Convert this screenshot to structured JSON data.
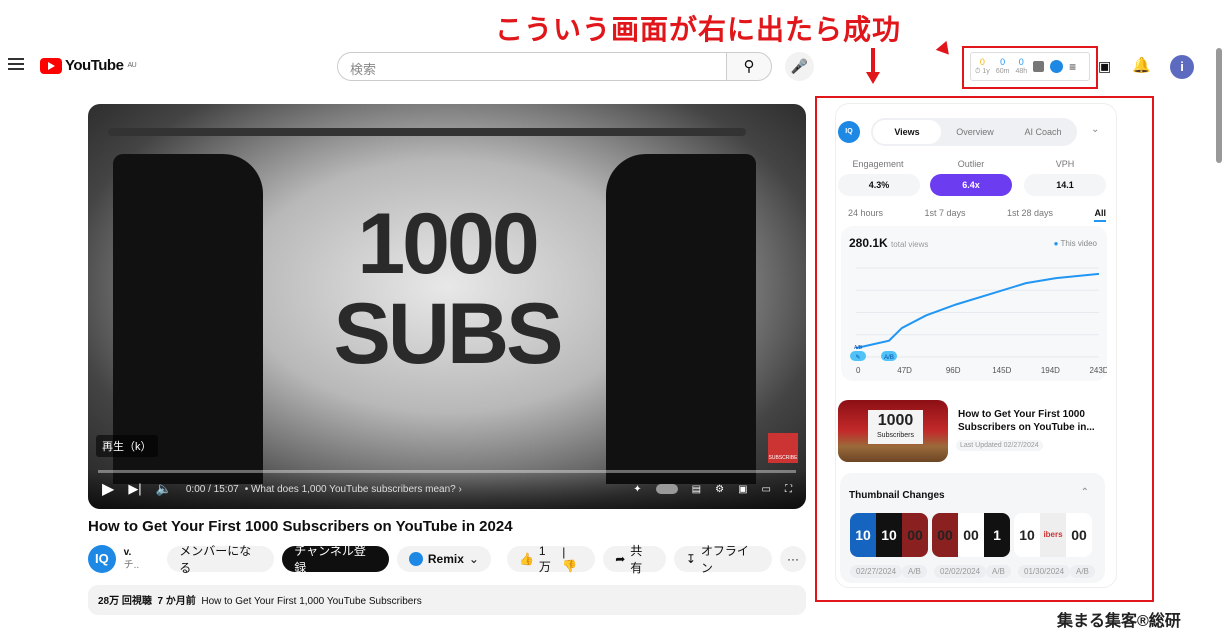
{
  "annotation": {
    "text": "こういう画面が右に出たら成功",
    "color": "#e0161a"
  },
  "watermark": "集まる集客®総研",
  "header": {
    "logo": "YouTube",
    "region": "AU",
    "search_placeholder": "検索",
    "avatar": "i"
  },
  "extension_bar": {
    "stats": [
      {
        "value": "0",
        "label": "⏱ 1y",
        "color": "#f5b400"
      },
      {
        "value": "0",
        "label": "60m",
        "color": "#2196f3"
      },
      {
        "value": "0",
        "label": "48h",
        "color": "#2196f3"
      }
    ]
  },
  "video": {
    "overlay_text": "1000 SUBS",
    "play_tooltip": "再生（k）",
    "time": "0:00 / 15:07",
    "chapter": "• What does 1,000 YouTube subscribers mean? ›",
    "subscribe_badge": "SUBSCRIBE"
  },
  "title": "How to Get Your First 1000 Subscribers on YouTube in 2024",
  "channel": {
    "name": "v.",
    "sub": "チ..",
    "join": "メンバーになる",
    "subscribe": "チャンネル登録",
    "remix": "Remix"
  },
  "actions": {
    "likes": "1万",
    "share": "共有",
    "offline": "オフライン",
    "more": "···"
  },
  "description": {
    "views": "28万 回視聴",
    "age": "7 か月前",
    "text": "How to Get Your First 1,000 YouTube Subscribers"
  },
  "panel": {
    "tabs": [
      "Views",
      "Overview",
      "AI Coach"
    ],
    "metrics": [
      {
        "label": "Engagement",
        "value": "4.3%"
      },
      {
        "label": "Outlier",
        "value": "6.4x"
      },
      {
        "label": "VPH",
        "value": "14.1"
      }
    ],
    "accent": "#6c3df0",
    "ranges": [
      "24 hours",
      "1st 7 days",
      "1st 28 days",
      "All"
    ],
    "total": "280.1K",
    "total_label": "total views",
    "legend": "This video",
    "video_card": {
      "title": "How to Get Your First 1000 Subscribers on YouTube in...",
      "updated": "Last Updated 02/27/2024",
      "thumb_text": "1000",
      "thumb_sub": "Subscribers"
    },
    "thumbnail_changes": {
      "title": "Thumbnail Changes",
      "groups": [
        {
          "date": "02/27/2024",
          "tag": "A/B"
        },
        {
          "date": "02/02/2024",
          "tag": "A/B"
        },
        {
          "date": "01/30/2024",
          "tag": "A/B"
        }
      ]
    }
  },
  "chart_data": {
    "type": "line",
    "x_ticks": [
      "0",
      "47D",
      "96D",
      "145D",
      "194D",
      "243D"
    ],
    "xlim": [
      0,
      243
    ],
    "ylim": [
      0,
      300000
    ],
    "grid": true,
    "legend": "top-right",
    "color": "#2196f3",
    "series": [
      {
        "name": "This video",
        "x": [
          0,
          33,
          46,
          70,
          100,
          140,
          170,
          200,
          243
        ],
        "y": [
          30000,
          55000,
          98000,
          140000,
          177000,
          218000,
          249000,
          266000,
          280100
        ]
      }
    ],
    "markers": [
      "A/B",
      "A/B"
    ]
  }
}
